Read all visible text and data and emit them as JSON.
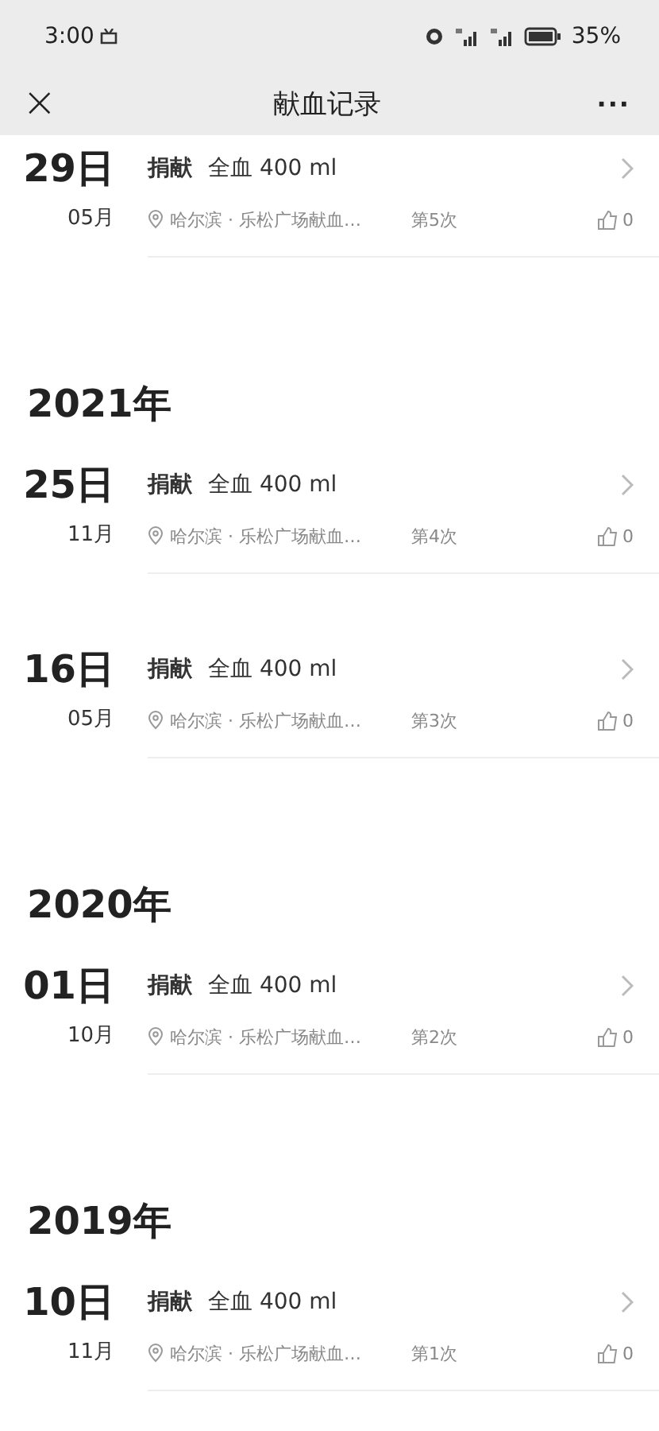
{
  "status_bar": {
    "time": "3:00",
    "battery": "35%"
  },
  "nav": {
    "close": "×",
    "title": "献血记录",
    "more": "···"
  },
  "groups": [
    {
      "records": [
        {
          "day": "29日",
          "month": "05月",
          "type": "捐献",
          "detail": "全血 400 ml",
          "location": "哈尔滨 · 乐松广场献血…",
          "count": "第5次",
          "likes": "0"
        }
      ]
    },
    {
      "year": "2021年",
      "records": [
        {
          "day": "25日",
          "month": "11月",
          "type": "捐献",
          "detail": "全血 400 ml",
          "location": "哈尔滨 · 乐松广场献血…",
          "count": "第4次",
          "likes": "0"
        },
        {
          "day": "16日",
          "month": "05月",
          "type": "捐献",
          "detail": "全血 400 ml",
          "location": "哈尔滨 · 乐松广场献血…",
          "count": "第3次",
          "likes": "0"
        }
      ]
    },
    {
      "year": "2020年",
      "records": [
        {
          "day": "01日",
          "month": "10月",
          "type": "捐献",
          "detail": "全血 400 ml",
          "location": "哈尔滨 · 乐松广场献血…",
          "count": "第2次",
          "likes": "0"
        }
      ]
    },
    {
      "year": "2019年",
      "records": [
        {
          "day": "10日",
          "month": "11月",
          "type": "捐献",
          "detail": "全血 400 ml",
          "location": "哈尔滨 · 乐松广场献血…",
          "count": "第1次",
          "likes": "0"
        }
      ]
    }
  ]
}
